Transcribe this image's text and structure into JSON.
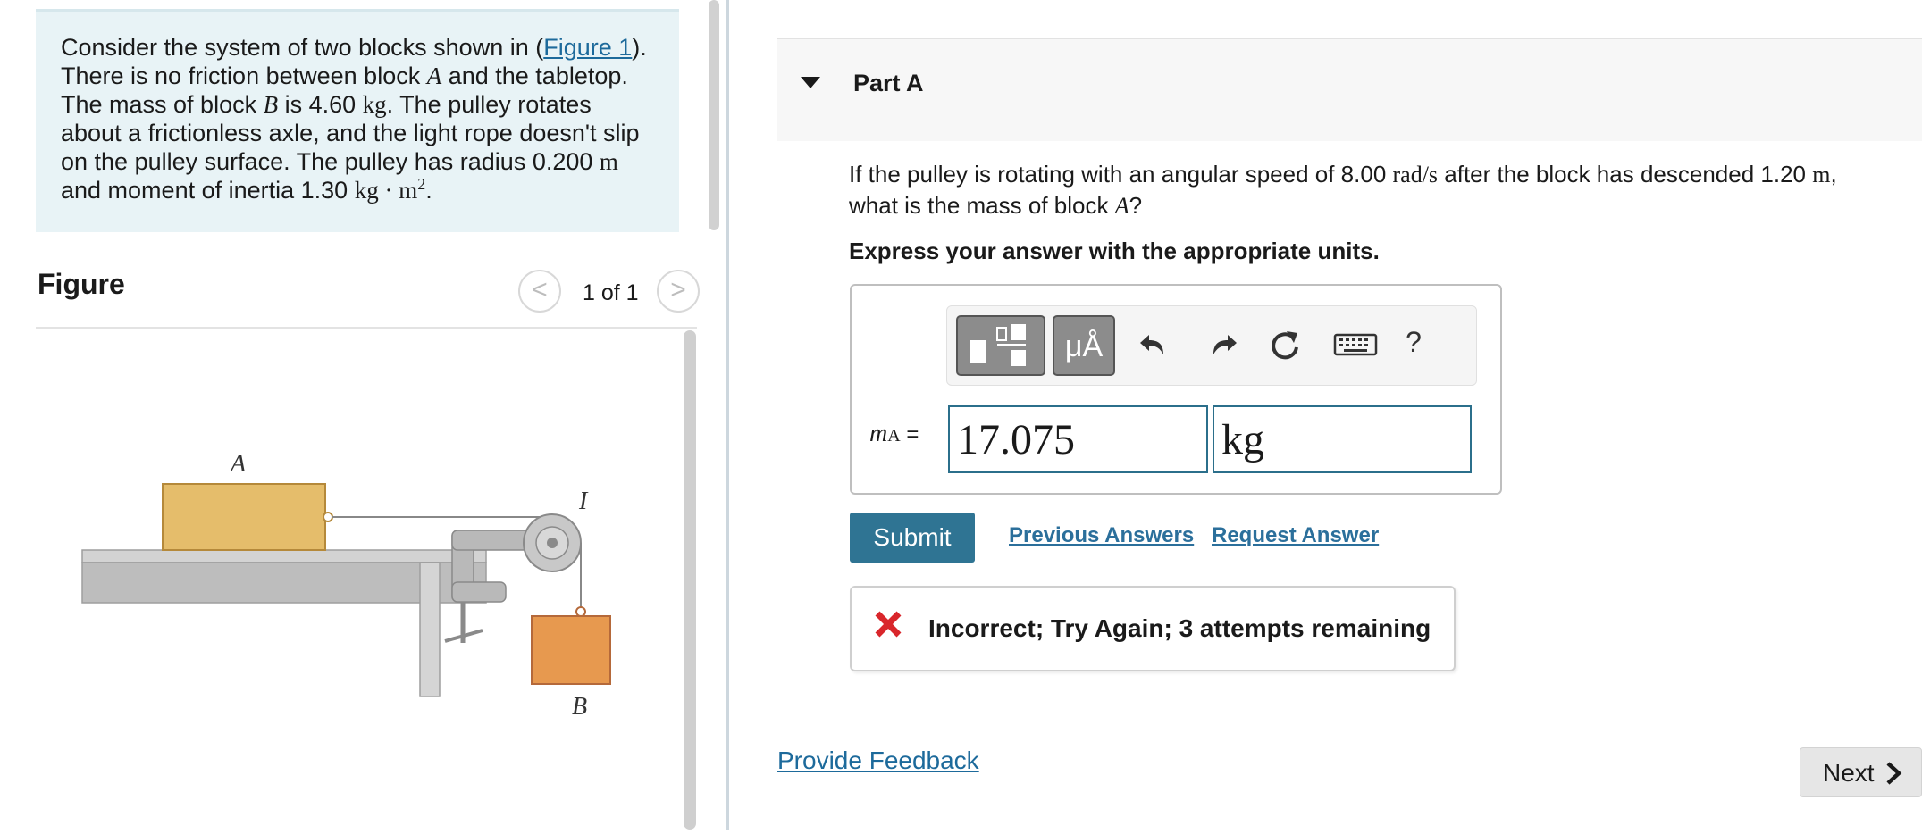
{
  "problem": {
    "t1": "Consider the system of two blocks shown in (",
    "figure_link": "Figure 1",
    "t2": "). There is no friction between block ",
    "block_a": "A",
    "t3": " and the tabletop. The mass of block ",
    "block_b": "B",
    "t4": " is 4.60 ",
    "unit_kg": "kg",
    "t5": ". The pulley rotates about a frictionless axle, and the light rope doesn't slip on the pulley surface. The pulley has radius 0.200 ",
    "unit_m": "m",
    "t6": " and moment of inertia 1.30 ",
    "unit_kgm": "kg · m",
    "exp": "2",
    "t7": "."
  },
  "figure": {
    "title": "Figure",
    "counter": "1 of 1",
    "prev_glyph": "<",
    "next_glyph": ">",
    "label_a": "A",
    "label_b": "B",
    "label_i": "I"
  },
  "part": {
    "title": "Part A",
    "question_1": "If the pulley is rotating with an angular speed of 8.00 ",
    "unit_rad": "rad/s",
    "question_2": " after the block has descended 1.20 ",
    "unit_m": "m",
    "question_3": ", what is the mass of block ",
    "block": "A",
    "question_4": "?",
    "instructions": "Express your answer with the appropriate units."
  },
  "toolbar": {
    "units_button_label": "μÅ",
    "help_label": "?",
    "icons": [
      "templates-icon",
      "units-icon",
      "undo-icon",
      "redo-icon",
      "reset-icon",
      "keyboard-icon",
      "help-icon"
    ]
  },
  "answer": {
    "label_var": "m",
    "label_sub": "A",
    "label_eq": " =",
    "value": "17.075",
    "unit": "kg"
  },
  "actions": {
    "submit": "Submit",
    "previous_answers": "Previous Answers",
    "request_answer": "Request Answer"
  },
  "feedback": {
    "message": "Incorrect; Try Again; 3 attempts remaining"
  },
  "footer": {
    "provide_feedback": "Provide Feedback",
    "next": "Next"
  },
  "colors": {
    "accent": "#2f7493",
    "link": "#1d6a9b",
    "problem_bg": "#e8f3f6",
    "error": "#d9262b",
    "block_a": "#e5bd6b",
    "block_b": "#e7994f"
  }
}
